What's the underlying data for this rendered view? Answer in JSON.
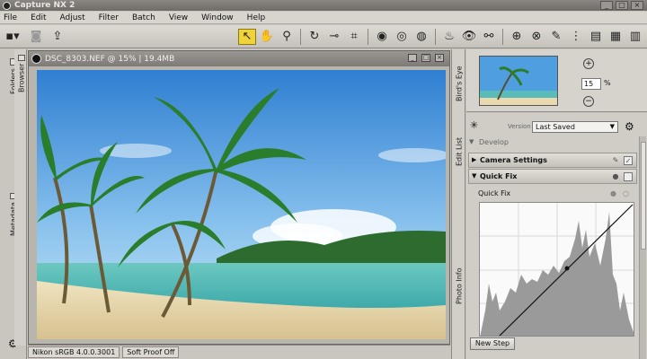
{
  "app": {
    "title": "Capture NX 2"
  },
  "menu": [
    "File",
    "Edit",
    "Adjust",
    "Filter",
    "Batch",
    "View",
    "Window",
    "Help"
  ],
  "window_buttons": [
    "_",
    "□",
    "×"
  ],
  "left_tabs": {
    "browser": "Browser",
    "folders": "Folders",
    "metadata": "Metadata"
  },
  "image_window": {
    "title": "DSC_8303.NEF @ 15% | 19.4MB"
  },
  "status": {
    "profile": "Nikon sRGB 4.0.0.3001",
    "soft_proof": "Soft Proof Off"
  },
  "right_tabs": {
    "birds_eye": "Bird's Eye",
    "edit_list": "Edit List",
    "photo_info": "Photo Info"
  },
  "birds_eye": {
    "zoom_value": "15",
    "zoom_unit": "%"
  },
  "edit_list": {
    "version_label": "Version",
    "version_value": "Last Saved",
    "develop_label": "Develop",
    "camera_settings": "Camera Settings",
    "quick_fix": "Quick Fix",
    "quick_fix_row": "Quick Fix",
    "new_step": "New Step"
  },
  "colors": {
    "select_tool": "#f0d23a",
    "sky": "#3f8fd8",
    "sea": "#4ab6b8",
    "sand": "#e8d9b0"
  },
  "icons": [
    "rotate-left-icon",
    "select-icon",
    "hand-icon",
    "zoom-icon",
    "rotate-icon",
    "straighten-icon",
    "crop-icon",
    "red-eye-icon",
    "black-point-icon",
    "white-point-icon",
    "auto-retouch-icon",
    "eye-icon",
    "link-icon",
    "gear-icon"
  ]
}
